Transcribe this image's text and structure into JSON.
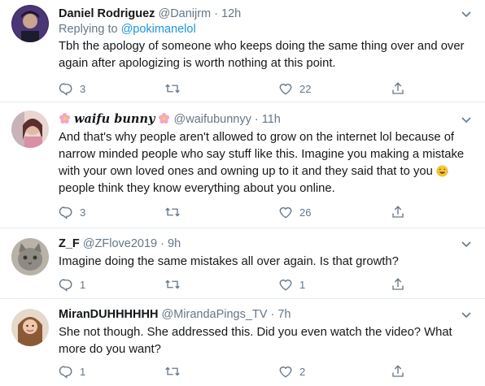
{
  "tweets": [
    {
      "name": "Daniel Rodriguez",
      "handle": "@Danijrm",
      "time": "12h",
      "replying_prefix": "Replying to ",
      "replying_to": "@pokimanelol",
      "text": "Tbh the apology of someone who keeps doing the same thing over and over again after apologizing is worth nothing at this point.",
      "replies": "3",
      "retweets": "",
      "likes": "22"
    },
    {
      "name_prefix_emoji": "flower-emoji",
      "name": "waifu bunny",
      "name_suffix_emoji": "flower-emoji",
      "handle": "@waifubunnyy",
      "time": "11h",
      "text": "And that's why people aren't allowed to grow on the internet lol because of narrow minded people  who say stuff like this. Imagine you making a mistake with your own loved ones and owning up to it and they said that to you",
      "text_end": "people think they know everything about you online.",
      "replies": "3",
      "retweets": "",
      "likes": "26"
    },
    {
      "name": "Z_F",
      "handle": "@ZFlove2019",
      "time": "9h",
      "text": "Imagine doing the same mistakes all over again. Is that growth?",
      "replies": "1",
      "retweets": "",
      "likes": "1"
    },
    {
      "name": "MiranDUHHHHHH",
      "handle": "@MirandaPings_TV",
      "time": "7h",
      "text": "She not though. She addressed this. Did you even watch the video? What more do you want?",
      "replies": "1",
      "retweets": "",
      "likes": "2"
    }
  ],
  "separator": " · ",
  "colors": {
    "text": "#14171a",
    "secondary": "#657786",
    "link": "#1b95e0",
    "divider": "#e6ecf0"
  },
  "icons": [
    "reply-icon",
    "retweet-icon",
    "like-icon",
    "share-icon",
    "caret-down-icon",
    "flower-emoji",
    "laughing-tears-emoji"
  ]
}
